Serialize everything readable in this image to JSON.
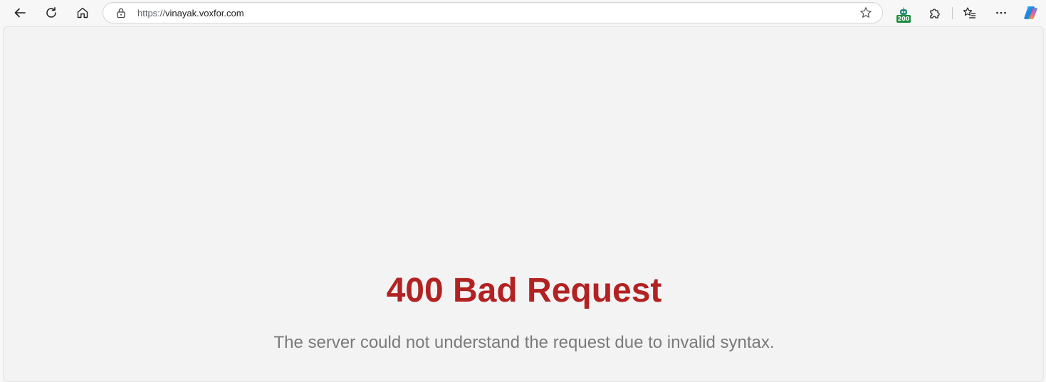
{
  "browser": {
    "url_protocol": "https://",
    "url_host": "vinayak.voxfor.com",
    "extension_badge": "200",
    "icons": {
      "back": "back-arrow-icon",
      "refresh": "refresh-icon",
      "home": "home-icon",
      "lock": "lock-icon",
      "favorite": "star-icon",
      "extension": "robot-extension-icon",
      "extensions": "puzzle-icon",
      "favorites": "favorites-list-icon",
      "more": "more-dots-icon",
      "copilot": "copilot-icon"
    }
  },
  "page": {
    "title": "400 Bad Request",
    "message": "The server could not understand the request due to invalid syntax.",
    "colors": {
      "title": "#b22222",
      "message": "#7a7a7a",
      "background": "#f3f3f3"
    }
  }
}
